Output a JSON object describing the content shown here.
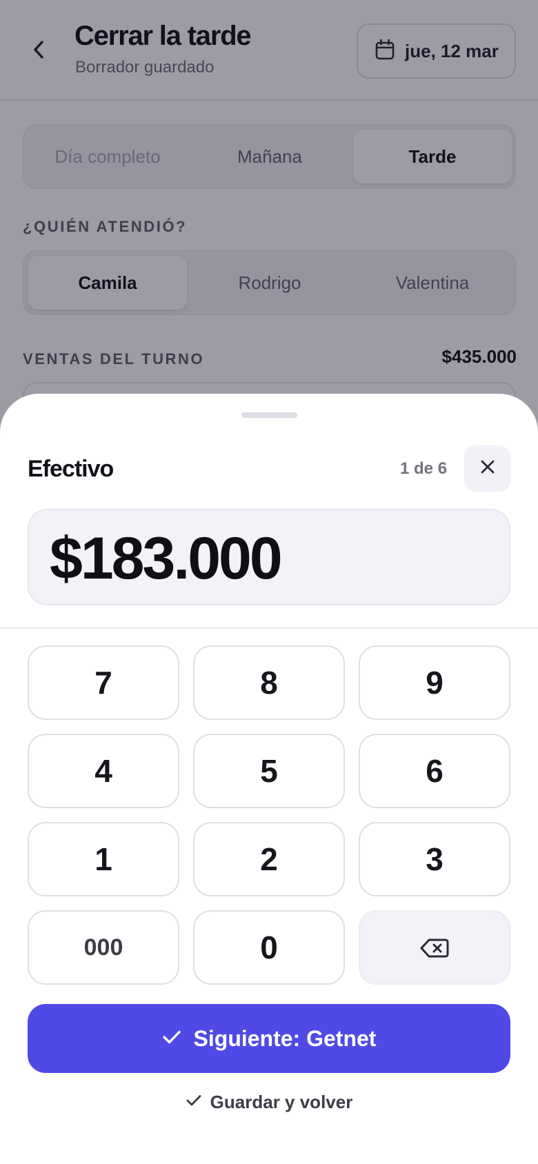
{
  "header": {
    "title": "Cerrar la tarde",
    "subtitle": "Borrador guardado",
    "date_label": "jue, 12 mar"
  },
  "shift_tabs": [
    {
      "label": "Día completo",
      "state": "disabled"
    },
    {
      "label": "Mañana",
      "state": "default"
    },
    {
      "label": "Tarde",
      "state": "selected"
    }
  ],
  "attendant": {
    "section_label": "¿QUIÉN ATENDIÓ?",
    "options": [
      {
        "label": "Camila",
        "state": "selected"
      },
      {
        "label": "Rodrigo",
        "state": "default"
      },
      {
        "label": "Valentina",
        "state": "default"
      }
    ]
  },
  "sales": {
    "section_label": "VENTAS DEL TURNO",
    "total": "$435.000"
  },
  "sheet": {
    "title": "Efectivo",
    "step": "1 de 6",
    "amount": "$183.000",
    "keypad": [
      "7",
      "8",
      "9",
      "4",
      "5",
      "6",
      "1",
      "2",
      "3",
      "000",
      "0"
    ],
    "keypad_backspace_icon": "backspace-icon",
    "primary_label": "Siguiente: Getnet",
    "secondary_label": "Guardar y volver"
  },
  "colors": {
    "accent": "#4f4ae6",
    "overlay": "rgba(20,20,40,0.42)",
    "amount_bg": "#f2f2f8"
  }
}
